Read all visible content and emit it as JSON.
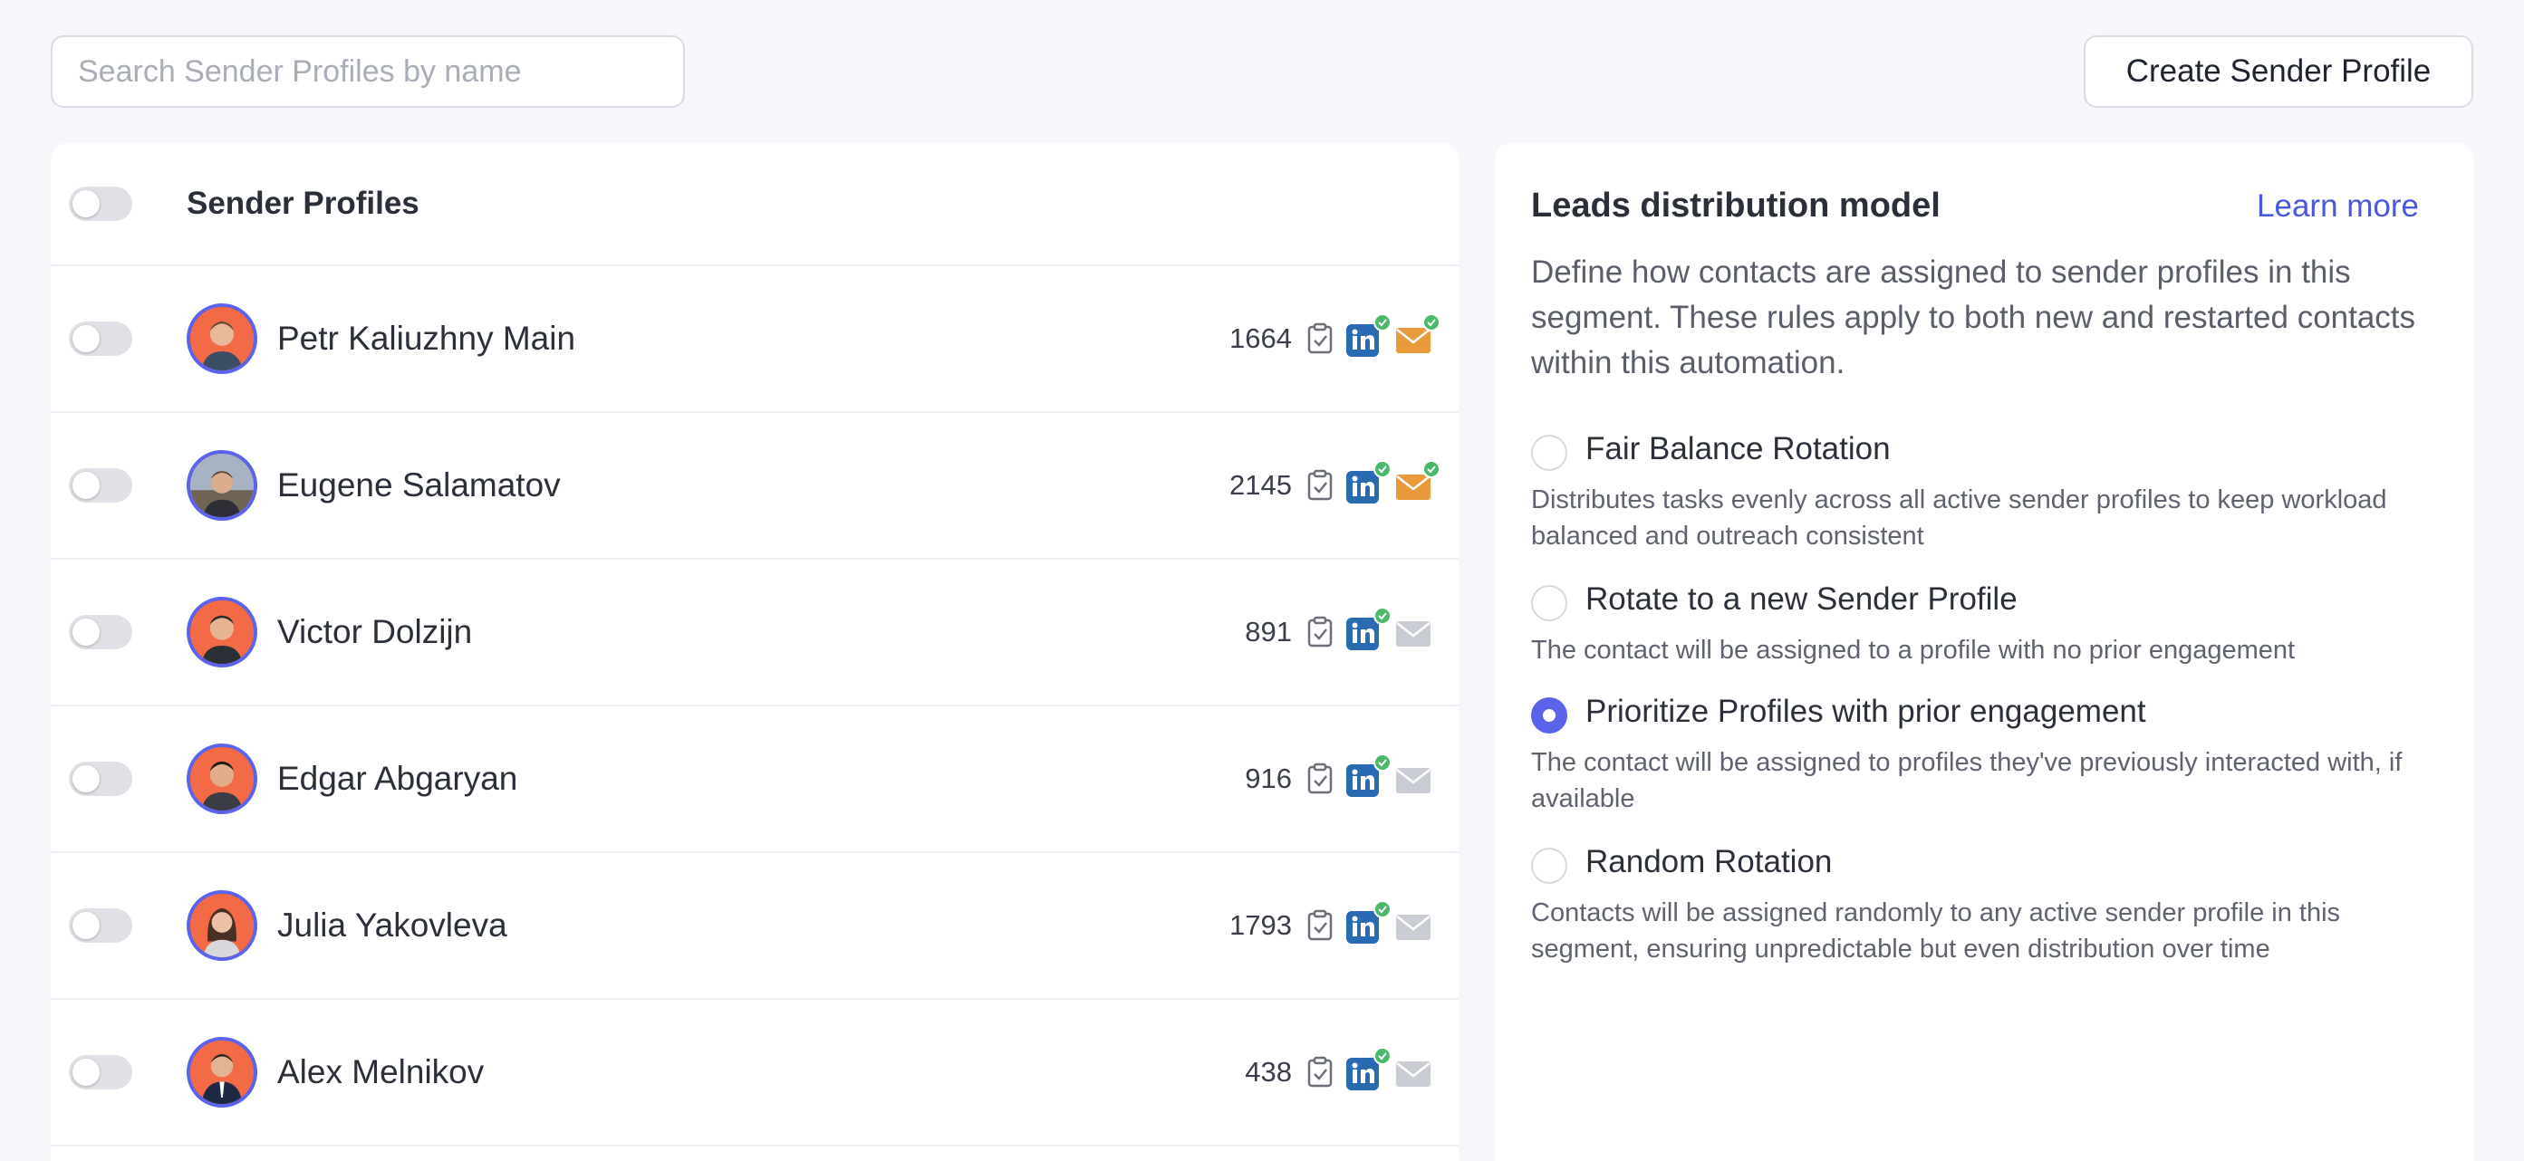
{
  "search": {
    "placeholder": "Search Sender Profiles by name"
  },
  "actions": {
    "create_label": "Create Sender Profile"
  },
  "profiles_panel": {
    "title": "Sender Profiles",
    "rows": [
      {
        "name": "Petr Kaliuzhny Main",
        "count": "1664",
        "linkedin_verified": true,
        "email_active": true,
        "avatar_bg": "#f26a46"
      },
      {
        "name": "Eugene Salamatov",
        "count": "2145",
        "linkedin_verified": true,
        "email_active": true,
        "avatar_bg": "#8b7a66"
      },
      {
        "name": "Victor Dolzijn",
        "count": "891",
        "linkedin_verified": true,
        "email_active": false,
        "avatar_bg": "#f26a46"
      },
      {
        "name": "Edgar Abgaryan",
        "count": "916",
        "linkedin_verified": true,
        "email_active": false,
        "avatar_bg": "#f26a46"
      },
      {
        "name": "Julia Yakovleva",
        "count": "1793",
        "linkedin_verified": true,
        "email_active": false,
        "avatar_bg": "#f26a46"
      },
      {
        "name": "Alex Melnikov",
        "count": "438",
        "linkedin_verified": true,
        "email_active": false,
        "avatar_bg": "#f26a46"
      }
    ]
  },
  "leads": {
    "title": "Leads distribution model",
    "learn_more": "Learn more",
    "description": "Define how contacts are assigned to sender profiles in this segment. These rules apply to both new and restarted contacts within this automation.",
    "options": [
      {
        "label": "Fair Balance Rotation",
        "description": "Distributes tasks evenly across all active sender profiles to keep workload balanced and outreach consistent",
        "selected": false
      },
      {
        "label": "Rotate to a new Sender Profile",
        "description": "The contact will be assigned to a profile with no prior engagement",
        "selected": false
      },
      {
        "label": "Prioritize Profiles with prior engagement",
        "description": "The contact will be assigned to profiles they've previously interacted with, if available",
        "selected": true
      },
      {
        "label": "Random Rotation",
        "description": "Contacts will be assigned randomly to any active sender profile in this segment, ensuring unpredictable but even distribution over time",
        "selected": false
      }
    ]
  },
  "colors": {
    "accent": "#5a63ea",
    "link": "#4a56e2",
    "linkedin": "#2a6ab2",
    "email_active": "#e89a3c",
    "email_inactive": "#c9ccd3",
    "verified": "#4bb96a"
  }
}
